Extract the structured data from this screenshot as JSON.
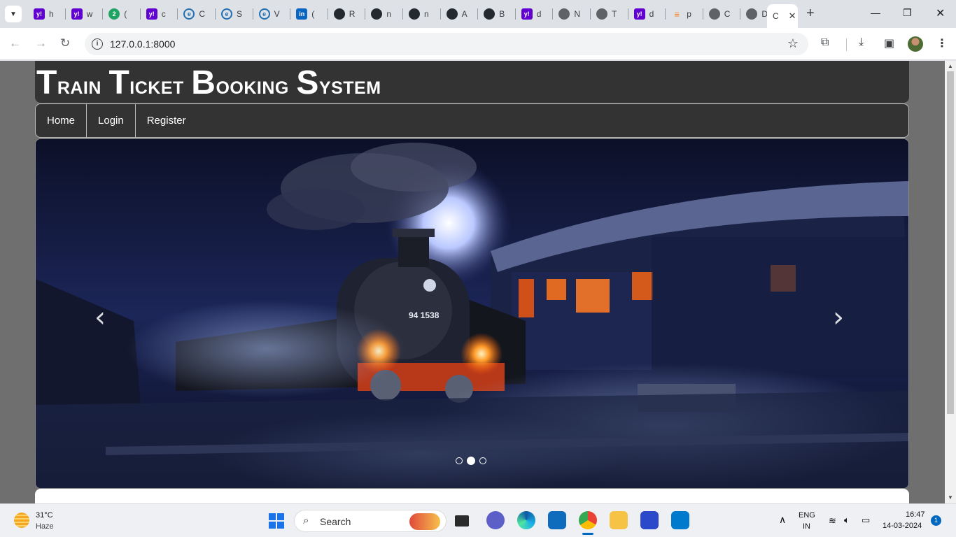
{
  "browser": {
    "tabs": [
      {
        "label": "h",
        "icon": "yahoo-icon",
        "color": "#6001d2"
      },
      {
        "label": "w",
        "icon": "yahoo-icon",
        "color": "#6001d2"
      },
      {
        "label": "(",
        "icon": "whatsapp-badge-icon",
        "badge": "2",
        "color": "#1ea362"
      },
      {
        "label": "c",
        "icon": "yahoo-icon",
        "color": "#6001d2"
      },
      {
        "label": "C",
        "icon": "edge-icon",
        "color": "#1f6fb5"
      },
      {
        "label": "S",
        "icon": "edge-icon",
        "color": "#1f6fb5"
      },
      {
        "label": "V",
        "icon": "edge-icon",
        "color": "#1f6fb5"
      },
      {
        "label": "(",
        "icon": "linkedin-icon",
        "color": "#0a66c2"
      },
      {
        "label": "R",
        "icon": "github-icon",
        "color": "#24292f"
      },
      {
        "label": "n",
        "icon": "github-icon",
        "color": "#24292f"
      },
      {
        "label": "n",
        "icon": "github-icon",
        "color": "#24292f"
      },
      {
        "label": "A",
        "icon": "github-icon",
        "color": "#24292f"
      },
      {
        "label": "B",
        "icon": "github-icon",
        "color": "#24292f"
      },
      {
        "label": "d",
        "icon": "yahoo-icon",
        "color": "#6001d2"
      },
      {
        "label": "N",
        "icon": "globe-icon",
        "color": "#5f6368"
      },
      {
        "label": "T",
        "icon": "globe-icon",
        "color": "#5f6368"
      },
      {
        "label": "d",
        "icon": "yahoo-icon",
        "color": "#6001d2"
      },
      {
        "label": "p",
        "icon": "stackoverflow-icon",
        "color": "#f48024"
      },
      {
        "label": "C",
        "icon": "globe-icon",
        "color": "#5f6368"
      },
      {
        "label": "D",
        "icon": "globe-icon",
        "color": "#5f6368"
      }
    ],
    "active_tab": {
      "label": "C",
      "close": "✕"
    },
    "new_tab": "+",
    "url": "127.0.0.1:8000"
  },
  "site": {
    "title_words": [
      {
        "first": "T",
        "rest": "rain"
      },
      {
        "first": "T",
        "rest": "icket"
      },
      {
        "first": "B",
        "rest": "ooking"
      },
      {
        "first": "S",
        "rest": "ystem"
      }
    ],
    "nav": [
      "Home",
      "Login",
      "Register"
    ],
    "carousel": {
      "prev": "‹",
      "next": "›",
      "slide_count": 3,
      "active_slide": 2,
      "plate_text": "94 1538"
    }
  },
  "taskbar": {
    "weather_temp": "31°C",
    "weather_desc": "Haze",
    "search_placeholder": "Search",
    "lang_top": "ENG",
    "lang_bottom": "IN",
    "time": "16:47",
    "date": "14-03-2024",
    "notifications": "1"
  }
}
